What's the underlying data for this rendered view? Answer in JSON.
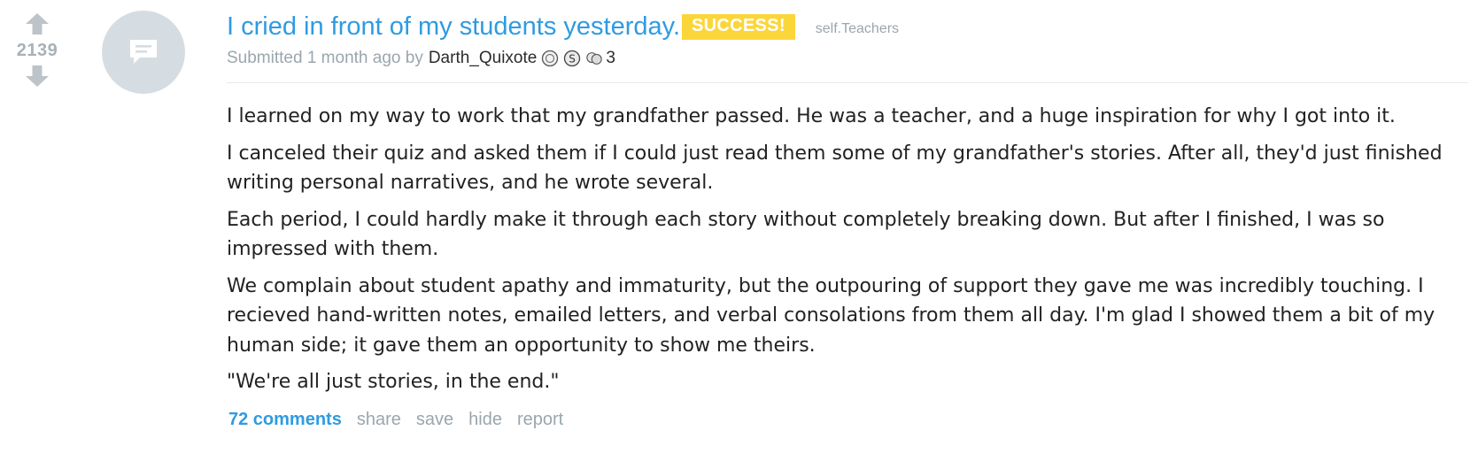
{
  "post": {
    "score": "2139",
    "title": "I cried in front of my students yesterday.",
    "flair": "SUCCESS!",
    "domain": "self.Teachers",
    "submitted_prefix": "Submitted",
    "time": "1 month ago",
    "by": "by",
    "author": "Darth_Quixote",
    "awards": [
      "silver-award-icon",
      "gold-award-icon",
      "helpful-award-icon"
    ],
    "award_count": "3",
    "paragraphs": [
      "I learned on my way to work that my grandfather passed. He was a teacher, and a huge inspiration for why I got into it.",
      "I canceled their quiz and asked them if I could just read them some of my grandfather's stories. After all, they'd just finished writing personal narratives, and he wrote several.",
      "Each period, I could hardly make it through each story without completely breaking down. But after I finished, I was so impressed with them.",
      "We complain about student apathy and immaturity, but the outpouring of support they gave me was incredibly touching. I recieved hand-written notes, emailed letters, and verbal consolations from them all day. I'm glad I showed them a bit of my human side; it gave them an opportunity to show me theirs.",
      "\"We're all just stories, in the end.\""
    ],
    "buttons": {
      "comments": "72 comments",
      "share": "share",
      "save": "save",
      "hide": "hide",
      "report": "report"
    }
  },
  "colors": {
    "title": "#2f9be1",
    "flair_bg": "#fbd63b",
    "muted": "#9aa6ad",
    "thumb_bg": "#d5dde2"
  }
}
